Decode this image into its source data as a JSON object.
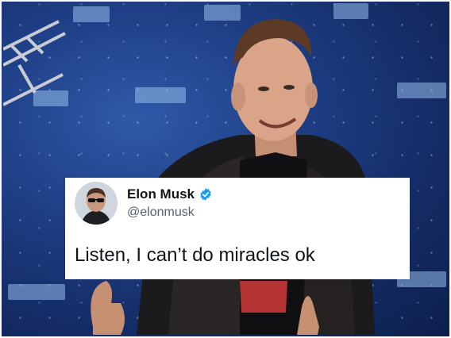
{
  "tweet": {
    "display_name": "Elon Musk",
    "handle": "@elonmusk",
    "text": "Listen, I can’t do miracles ok",
    "verified": true
  },
  "colors": {
    "backdrop": "#1f3f86",
    "verified_badge": "#1d9bf0",
    "tweet_text": "#0f1419",
    "handle_text": "#536471"
  },
  "icons": {
    "verified": "verified-badge-icon"
  }
}
